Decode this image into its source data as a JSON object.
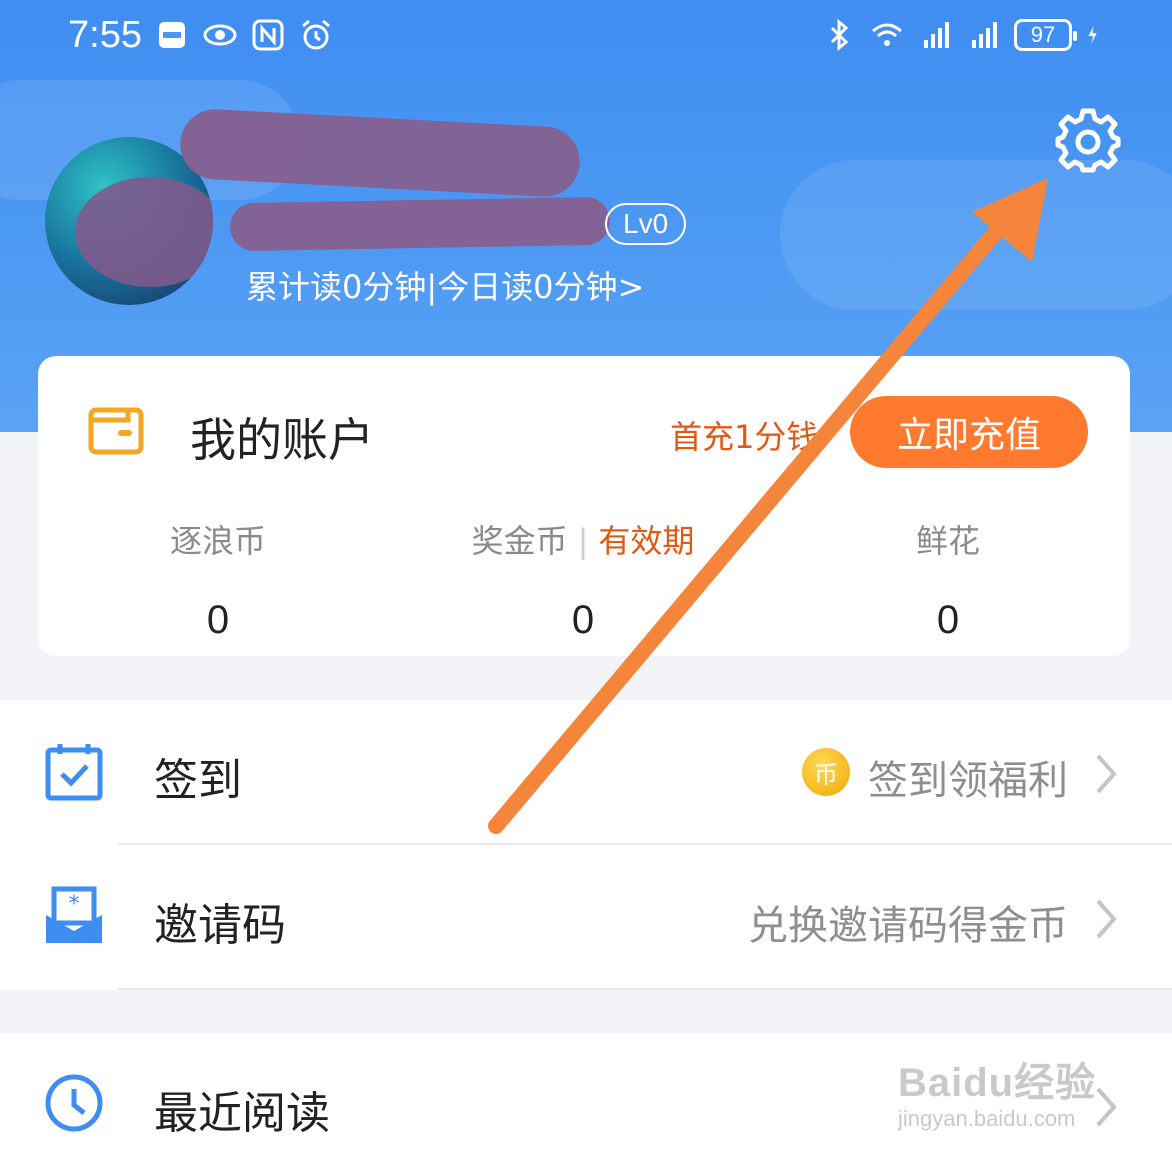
{
  "status_bar": {
    "time": "7:55",
    "battery": "97",
    "left_icons": [
      "huawei-app-icon",
      "eye-icon",
      "nfc-icon",
      "alarm-icon"
    ],
    "right_icons": [
      "bluetooth-icon",
      "wifi-icon",
      "signal-4g-icon",
      "signal-4g-icon",
      "battery-icon",
      "charging-icon"
    ]
  },
  "profile": {
    "level": "Lv0",
    "reading_stats": "累计读0分钟|今日读0分钟>"
  },
  "account": {
    "title": "我的账户",
    "promo": "首充1分钱",
    "recharge_label": "立即充值",
    "stats": [
      {
        "label": "逐浪币",
        "value": "0"
      },
      {
        "label": "奖金币",
        "extra": "有效期",
        "value": "0"
      },
      {
        "label": "鲜花",
        "value": "0"
      }
    ]
  },
  "menu": {
    "sign_in": {
      "label": "签到",
      "coin": "币",
      "hint": "签到领福利"
    },
    "invite": {
      "label": "邀请码",
      "hint": "兑换邀请码得金币"
    },
    "recent": {
      "label": "最近阅读"
    }
  },
  "watermark": {
    "main": "Baidu经验",
    "sub": "jingyan.baidu.com"
  },
  "colors": {
    "header_blue": "#4a97f3",
    "accent_orange": "#ff7a2f",
    "promo_red": "#e05a14",
    "icon_blue": "#3d8ef0",
    "annotation_arrow": "#f5853a"
  }
}
